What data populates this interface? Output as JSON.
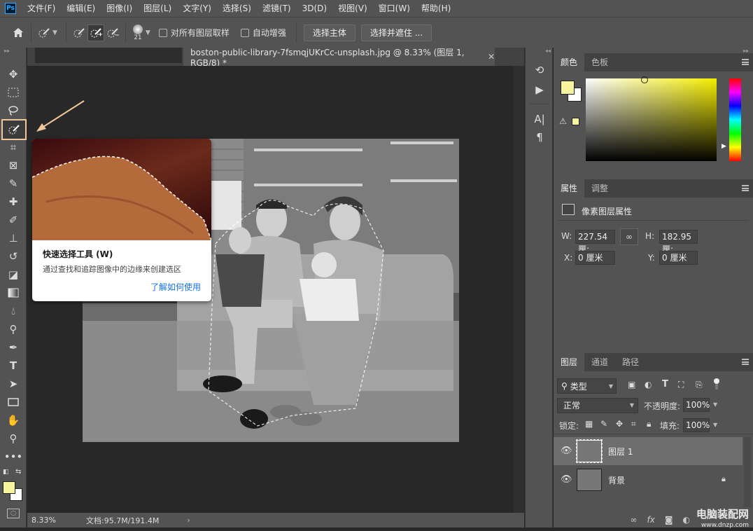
{
  "app": {
    "logo": "Ps"
  },
  "menu": [
    "文件(F)",
    "编辑(E)",
    "图像(I)",
    "图层(L)",
    "文字(Y)",
    "选择(S)",
    "滤镜(T)",
    "3D(D)",
    "视图(V)",
    "窗口(W)",
    "帮助(H)"
  ],
  "options": {
    "brush_size": "21",
    "sample_all_layers": "对所有图层取样",
    "auto_enhance": "自动增强",
    "select_subject": "选择主体",
    "select_and_mask": "选择并遮住 ..."
  },
  "document": {
    "tab_title": "boston-public-library-7fsmqjUKrCc-unsplash.jpg @ 8.33% (图层 1, RGB/8) *",
    "zoom": "8.33%",
    "doc_size": "文档:95.7M/191.4M"
  },
  "tooltip": {
    "title": "快速选择工具 (W)",
    "description": "通过查找和追踪图像中的边缘来创建选区",
    "link": "了解如何使用"
  },
  "colors": {
    "foreground": "#f8f5a0",
    "background": "#ffffff",
    "highlight": "#f0c79a",
    "accent": "#1473e6"
  },
  "color_panel": {
    "tabs": [
      "颜色",
      "色板"
    ]
  },
  "properties_panel": {
    "tabs": [
      "属性",
      "调整"
    ],
    "section": "像素图层属性",
    "w_label": "W:",
    "w_value": "227.54 厘:",
    "h_label": "H:",
    "h_value": "182.95 厘:",
    "x_label": "X:",
    "x_value": "0 厘米",
    "y_label": "Y:",
    "y_value": "0 厘米"
  },
  "layers_panel": {
    "tabs": [
      "图层",
      "通道",
      "路径"
    ],
    "filter": "类型",
    "blend_mode": "正常",
    "opacity_label": "不透明度:",
    "opacity_value": "100%",
    "lock_label": "锁定:",
    "fill_label": "填充:",
    "fill_value": "100%",
    "layers": [
      {
        "name": "图层 1",
        "selected": true
      },
      {
        "name": "背景",
        "locked": true
      }
    ]
  },
  "watermark": {
    "line1": "电脑装配网",
    "line2": "www.dnzp.com"
  }
}
